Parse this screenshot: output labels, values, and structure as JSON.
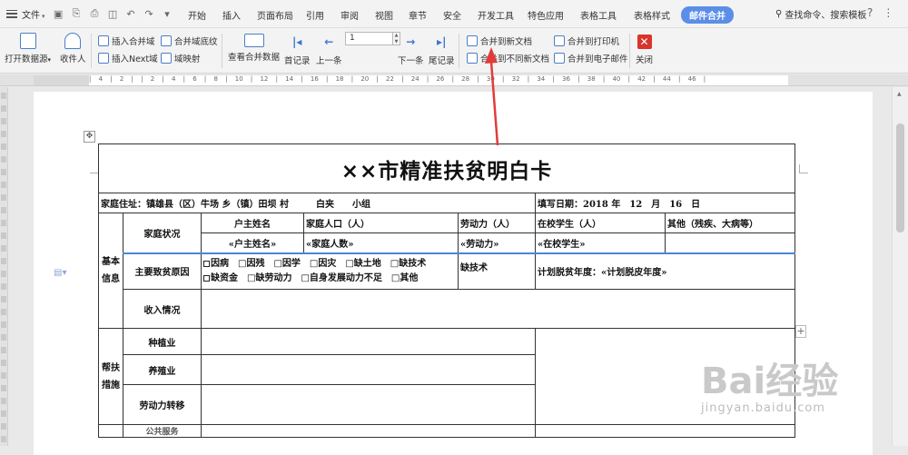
{
  "menubar": {
    "file_label": "文件",
    "tabs": [
      "开始",
      "插入",
      "页面布局",
      "引用",
      "审阅",
      "视图",
      "章节",
      "安全",
      "开发工具",
      "特色应用",
      "表格工具",
      "表格样式",
      "邮件合并"
    ],
    "search_label": "查找命令、搜索模板",
    "accent": "#5a8ee8"
  },
  "ribbon": {
    "open_datasource": "打开数据源",
    "recipients": "收件人",
    "insert_merge_field": "插入合并域",
    "insert_next_field": "插入Next域",
    "merge_field_shading": "合并域底纹",
    "field_mapping": "域映射",
    "view_merged_data": "查看合并数据",
    "first_record": "首记录",
    "prev_record": "上一条",
    "record_value": "1",
    "next_record": "下一条",
    "last_record": "尾记录",
    "merge_to_new_doc": "合并到新文档",
    "merge_to_diff_new_docs": "合并到不同新文档",
    "merge_to_printer": "合并到打印机",
    "merge_to_email": "合并到电子邮件",
    "close": "关闭"
  },
  "ruler": {
    "numbers": "| 4 | 2 | | 2 | 4 | 6 | 8 | 10 | 12 | 14 | 16 | 18 | 20 | 22 | 24 | 26 | 28 | 30 | 32 | 34 | 36 | 38 | 40 | 42 | 44 | 46 |"
  },
  "document": {
    "title": "××市精准扶贫明白卡",
    "address_label": "家庭住址：",
    "address_value": "镇雄县（区）牛场 乡（镇）田坝 村　　　白夹　　小组",
    "fill_date": "填写日期：2018 年　12　月　16　日",
    "section_basic": "基本信息",
    "family_status": "家庭状况",
    "head_name": "户主姓名",
    "family_size": "家庭人口（人）",
    "labor": "劳动力（人）",
    "students": "在校学生（人）",
    "others": "其他（残疾、大病等）",
    "field_head_name": "«户主姓名»",
    "field_family_size": "«家庭人数»",
    "field_labor": "«劳动力»",
    "field_students": "«在校学生»",
    "poverty_cause": "主要致贫原因",
    "causes_line1": "因病　□因残　□因学　□因灾　□缺土地　□缺技术",
    "causes_line2": "缺资金　□缺劳动力　□自身发展动力不足　□其他",
    "cause_value": "缺技术",
    "plan_year": "计划脱贫年度：«计划脱皮年度»",
    "income": "收入情况",
    "section_help": "帮扶措施",
    "planting": "种植业",
    "breeding": "养殖业",
    "labor_transfer": "劳动力转移",
    "next_row_partial": "公共服务"
  },
  "watermark": {
    "brand": "Bai经验",
    "url": "jingyan.baidu.com"
  }
}
